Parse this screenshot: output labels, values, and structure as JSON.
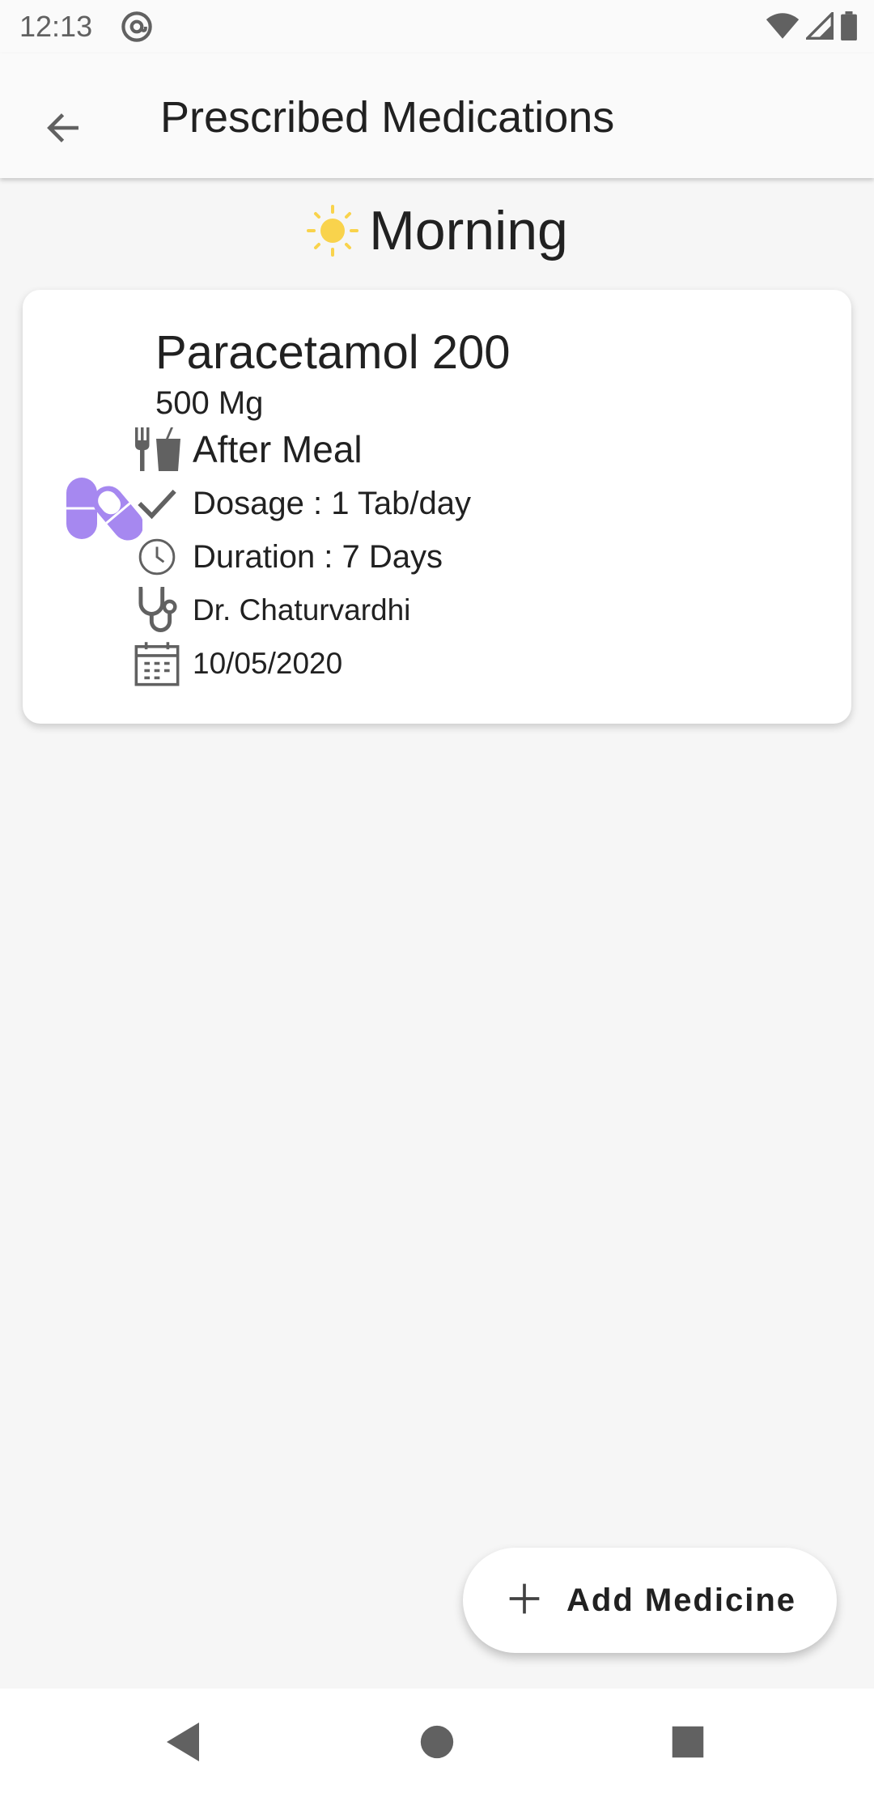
{
  "status_bar": {
    "time": "12:13",
    "icons": [
      "at-sign-icon",
      "wifi-icon",
      "signal-icon",
      "battery-icon"
    ]
  },
  "app_bar": {
    "title": "Prescribed Medications",
    "back_icon": "arrow-back-icon"
  },
  "section": {
    "title": "Morning",
    "icon": "sun-icon",
    "icon_color": "#f9d34c"
  },
  "medication": {
    "name": "Paracetamol 200",
    "strength": "500 Mg",
    "meal": "After Meal",
    "dosage": "Dosage : 1 Tab/day",
    "duration": "Duration : 7 Days",
    "doctor": "Dr. Chaturvardhi",
    "date": "10/05/2020",
    "icon": "pill-capsule-icon",
    "icon_color": "#a688f0"
  },
  "fab": {
    "label": "Add Medicine",
    "icon": "plus-icon"
  },
  "nav_bar": {
    "icons": [
      "nav-back-icon",
      "nav-home-icon",
      "nav-recents-icon"
    ]
  }
}
